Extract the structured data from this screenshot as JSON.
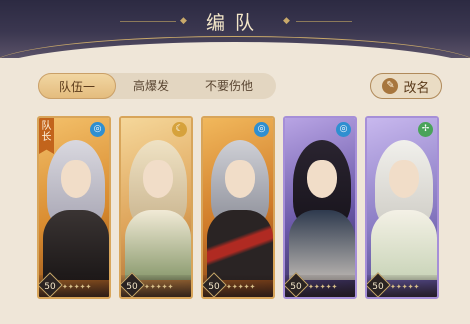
{
  "header": {
    "title": "编队"
  },
  "tabs": [
    {
      "label": "队伍一",
      "active": true
    },
    {
      "label": "高爆发",
      "active": false
    },
    {
      "label": "不要伤他",
      "active": false
    }
  ],
  "rename": {
    "label": "改名",
    "icon": "pen-icon"
  },
  "captain_label": "队长",
  "cards": [
    {
      "level": "50",
      "stars": "✦✦✦✦✦",
      "element_icon": "water-swirl-icon",
      "element_color": "#2f8fd0",
      "theme": "gold"
    },
    {
      "level": "50",
      "stars": "✦✦✦✦✦",
      "element_icon": "moon-icon",
      "element_color": "#d6a23c",
      "theme": "gold"
    },
    {
      "level": "50",
      "stars": "✦✦✦✦✦",
      "element_icon": "water-swirl-icon",
      "element_color": "#2f8fd0",
      "theme": "gold"
    },
    {
      "level": "50",
      "stars": "✦✦✦✦✦",
      "element_icon": "water-swirl-icon",
      "element_color": "#2f8fd0",
      "theme": "purple"
    },
    {
      "level": "50",
      "stars": "✦✦✦✦✦",
      "element_icon": "leaf-icon",
      "element_color": "#4aa35a",
      "theme": "purple"
    }
  ]
}
